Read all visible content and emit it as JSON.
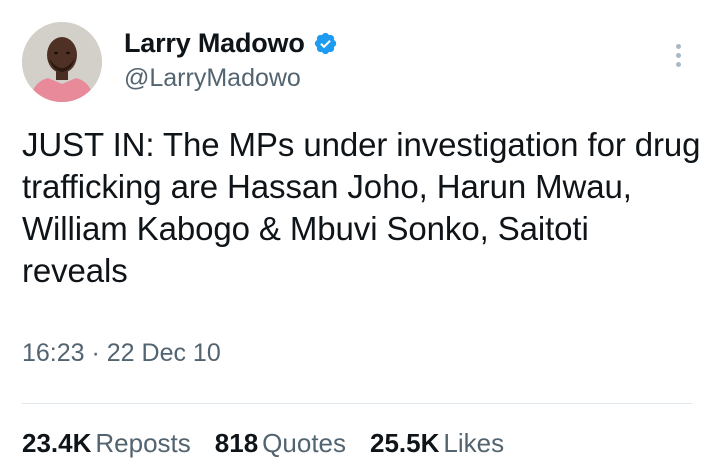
{
  "author": {
    "display_name": "Larry Madowo",
    "handle": "@LarryMadowo",
    "verified": true,
    "verified_color": "#1d9bf0"
  },
  "tweet": {
    "text": "JUST IN: The MPs under investigation for drug trafficking are Hassan Joho, Harun Mwau, William Kabogo & Mbuvi Sonko, Saitoti reveals",
    "timestamp": "16:23 · 22 Dec 10"
  },
  "stats": {
    "reposts_count": "23.4K",
    "reposts_label": "Reposts",
    "quotes_count": "818",
    "quotes_label": "Quotes",
    "likes_count": "25.5K",
    "likes_label": "Likes"
  },
  "icons": {
    "more": "more-vertical-icon",
    "verified": "verified-badge-icon",
    "avatar": "avatar"
  }
}
